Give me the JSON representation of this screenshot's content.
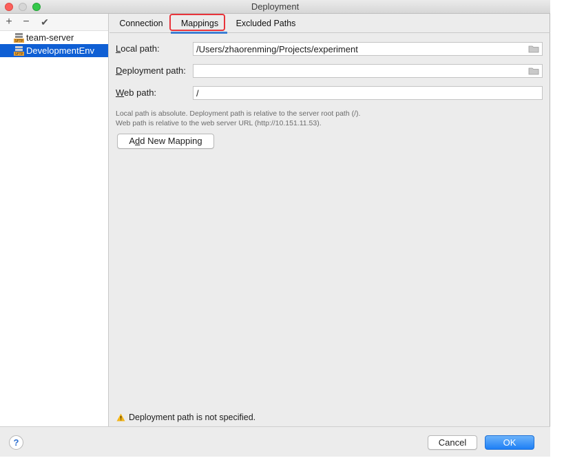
{
  "window": {
    "title": "Deployment"
  },
  "left_toolbar": {
    "add": "+",
    "remove": "−",
    "apply": "✔"
  },
  "servers": [
    {
      "name": "team-server",
      "selected": false,
      "icon": "sftp-server-icon"
    },
    {
      "name": "DevelopmentEnv",
      "selected": true,
      "icon": "sftp-server-icon"
    }
  ],
  "tabs": [
    {
      "label": "Connection",
      "active": false
    },
    {
      "label": "Mappings",
      "active": true
    },
    {
      "label": "Excluded Paths",
      "active": false
    }
  ],
  "fields": {
    "local_path": {
      "label_prefix": "L",
      "label_rest": "ocal path:",
      "value": "/Users/zhaorenming/Projects/experiment"
    },
    "deployment_path": {
      "label_prefix": "D",
      "label_rest": "eployment path:",
      "value": ""
    },
    "web_path": {
      "label_prefix": "W",
      "label_rest": "eb path:",
      "value": "/"
    }
  },
  "hints": {
    "line1": "Local path is absolute. Deployment path is relative to the server root path (/).",
    "line2": "Web path is relative to the web server URL (http://10.151.11.53)."
  },
  "add_mapping_button": {
    "label_prefix": "A",
    "label_underline": "d",
    "label_rest": "d New Mapping"
  },
  "warning": {
    "text": "Deployment path is not specified.",
    "icon": "warning-icon"
  },
  "footer": {
    "help": "?",
    "cancel": "Cancel",
    "ok": "OK"
  },
  "colors": {
    "accent": "#0f5fd4",
    "highlight_box": "#e8333a",
    "ok_button": "#1e7ff5"
  }
}
